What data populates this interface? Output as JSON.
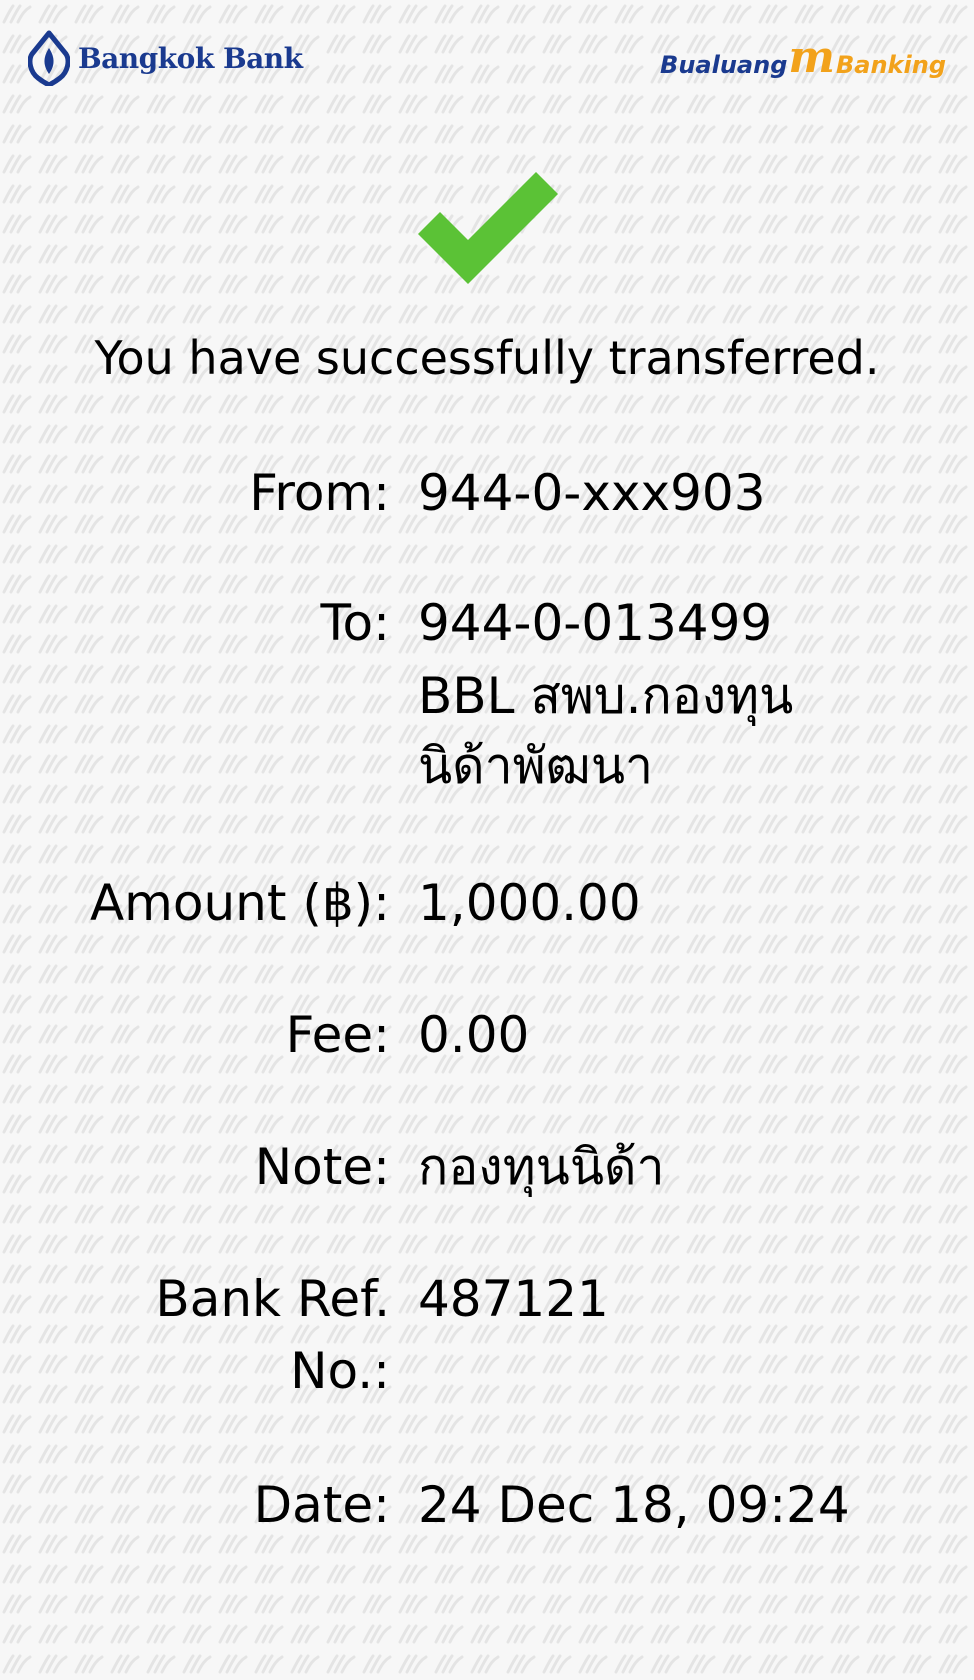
{
  "header": {
    "bank_name": "Bangkok Bank",
    "app_logo_left": "Bualuang",
    "app_logo_mark": "m",
    "app_logo_right": "Banking"
  },
  "status": {
    "message": "You have successfully transferred.",
    "icon": "check-icon"
  },
  "details": {
    "from": {
      "label": "From:",
      "value": "944-0-xxx903"
    },
    "to": {
      "label": "To:",
      "value_line1": "944-0-013499",
      "value_line2": "BBL สพบ.กองทุน",
      "value_line3": "นิด้าพัฒนา"
    },
    "amount": {
      "label": "Amount (฿):",
      "value": "1,000.00"
    },
    "fee": {
      "label": "Fee:",
      "value": "0.00"
    },
    "note": {
      "label": "Note:",
      "value": "กองทุนนิด้า"
    },
    "ref": {
      "label_line1": "Bank Ref.",
      "label_line2": "No.:",
      "value": "487121"
    },
    "date": {
      "label": "Date:",
      "value": "24 Dec 18, 09:24"
    }
  },
  "colors": {
    "brand_blue": "#1a3a8f",
    "brand_orange": "#f2a21b",
    "success_green": "#5bc236",
    "watermark": "#e6e6e6"
  }
}
